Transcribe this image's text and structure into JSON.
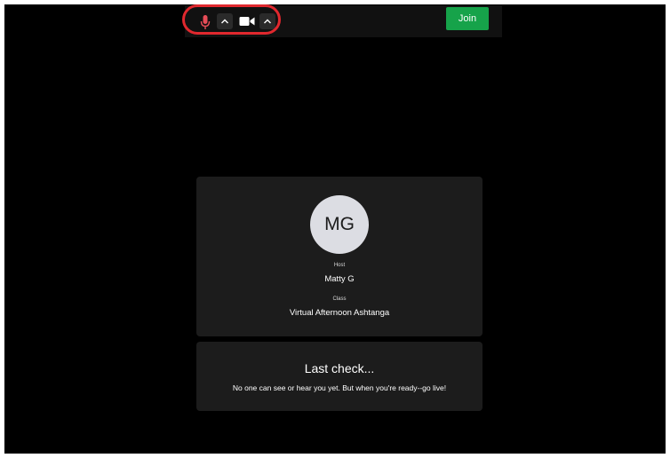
{
  "toolbar": {
    "join_label": "Join",
    "icons": [
      "microphone-icon",
      "chevron-up-icon",
      "video-camera-icon",
      "chevron-up-icon"
    ],
    "highlight_color": "#e0282e",
    "join_color": "#16a34a"
  },
  "session": {
    "avatar_initials": "MG",
    "host_label": "Host",
    "host_name": "Matty G",
    "class_label": "Class",
    "class_name": "Virtual Afternoon Ashtanga"
  },
  "last_check": {
    "title": "Last check...",
    "message": "No one can see or hear you yet. But when you're ready--go live!"
  }
}
